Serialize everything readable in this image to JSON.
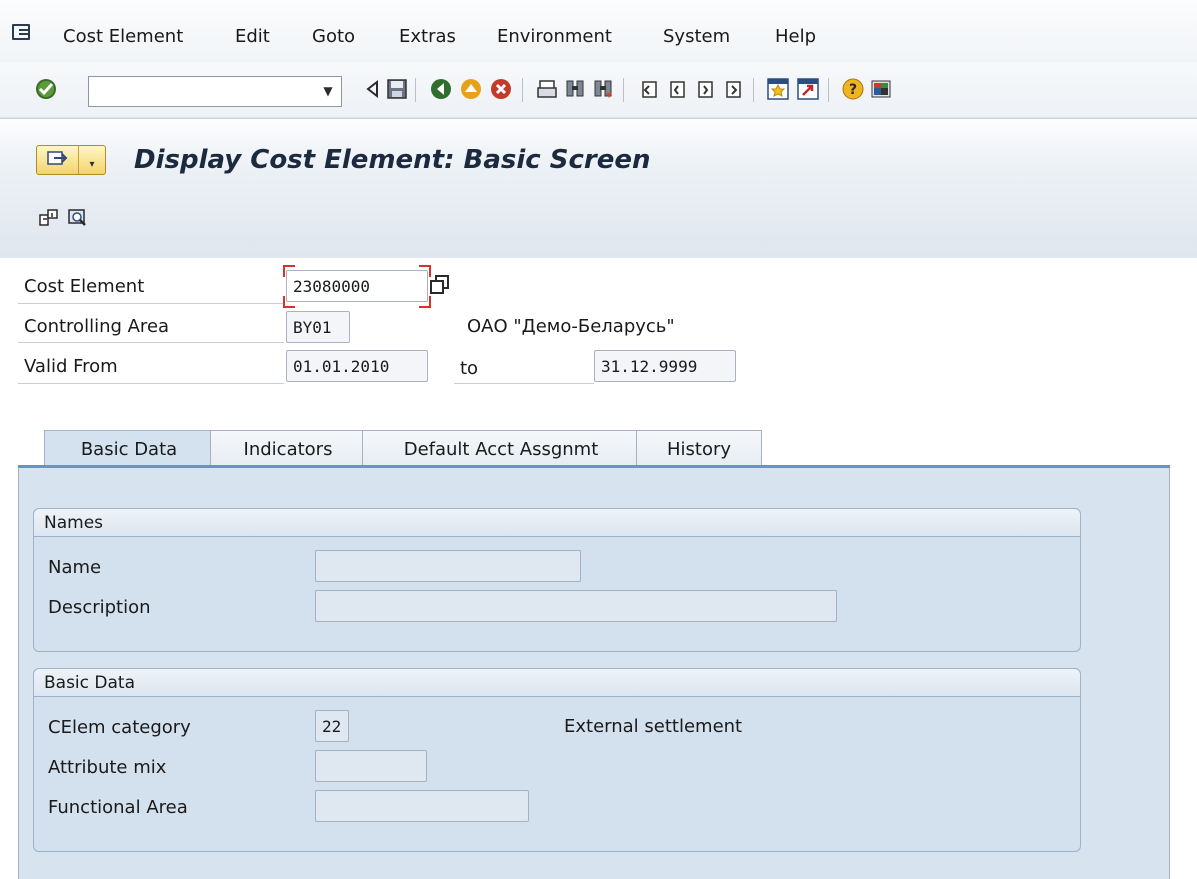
{
  "menubar": {
    "items": [
      "Cost Element",
      "Edit",
      "Goto",
      "Extras",
      "Environment",
      "System",
      "Help"
    ]
  },
  "toolbar": {
    "command_value": "",
    "icons": [
      "enter-icon",
      "back-nav-icon",
      "save-icon",
      "back-icon",
      "exit-icon",
      "cancel-icon",
      "print-icon",
      "find-icon",
      "find-next-icon",
      "first-page-icon",
      "previous-page-icon",
      "next-page-icon",
      "last-page-icon",
      "create-session-icon",
      "shortcut-icon",
      "help-icon",
      "customize-layout-icon"
    ]
  },
  "title": {
    "text": "Display Cost Element: Basic Screen"
  },
  "header": {
    "cost_element_label": "Cost Element",
    "cost_element_value": "23080000",
    "controlling_area_label": "Controlling Area",
    "controlling_area_value": "BY01",
    "controlling_area_name": "ОАО \"Демо-Беларусь\"",
    "valid_from_label": "Valid From",
    "valid_from_value": "01.01.2010",
    "to_label": "to",
    "valid_to_value": "31.12.9999"
  },
  "tabs": [
    {
      "label": "Basic Data",
      "active": true
    },
    {
      "label": "Indicators",
      "active": false
    },
    {
      "label": "Default Acct Assgnmt",
      "active": false
    },
    {
      "label": "History",
      "active": false
    }
  ],
  "names_group": {
    "title": "Names",
    "name_label": "Name",
    "name_value": "",
    "description_label": "Description",
    "description_value": ""
  },
  "basic_group": {
    "title": "Basic Data",
    "celem_category_label": "CElem category",
    "celem_category_value": "22",
    "celem_category_text": "External settlement",
    "attribute_mix_label": "Attribute mix",
    "attribute_mix_value": "",
    "functional_area_label": "Functional Area",
    "functional_area_value": ""
  },
  "colors": {
    "accent": "#6e93b8",
    "panel": "#d7e4f0",
    "focus": "#d8332a"
  }
}
